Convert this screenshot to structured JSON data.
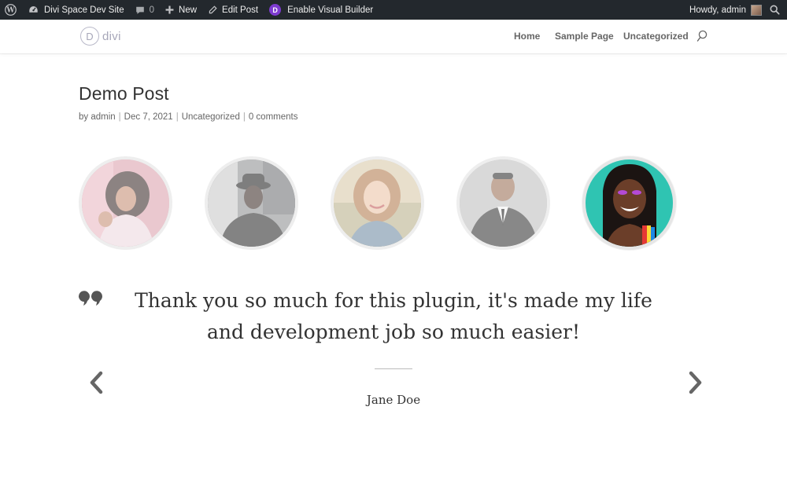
{
  "admin_bar": {
    "site_name": "Divi Space Dev Site",
    "comments_count": "0",
    "new_label": "New",
    "edit_label": "Edit Post",
    "divi_badge": "D",
    "visual_builder_label": "Enable Visual Builder",
    "howdy": "Howdy, admin"
  },
  "header": {
    "logo_letter": "D",
    "logo_text": "divi",
    "nav": [
      {
        "label": "Home"
      },
      {
        "label": "Sample Page"
      },
      {
        "label": "Uncategorized"
      }
    ]
  },
  "post": {
    "title": "Demo Post",
    "meta": {
      "by": "by admin",
      "date": "Dec 7, 2021",
      "category": "Uncategorized",
      "comments": "0 comments",
      "separator": "|"
    }
  },
  "testimonials": {
    "avatars": [
      {
        "name": "avatar-1",
        "active": false
      },
      {
        "name": "avatar-2",
        "active": false
      },
      {
        "name": "avatar-3",
        "active": false
      },
      {
        "name": "avatar-4",
        "active": false
      },
      {
        "name": "avatar-5",
        "active": true
      }
    ],
    "quote": "Thank you so much for this plugin, it's made my life and development job so much easier!",
    "author": "Jane Doe"
  },
  "icons": {
    "wordpress": "wordpress-icon",
    "dashboard": "dashboard-icon",
    "comment": "comment-icon",
    "plus": "plus-icon",
    "pencil": "pencil-icon",
    "search": "search-icon",
    "quote": "quote-icon",
    "prev": "chevron-left-icon",
    "next": "chevron-right-icon"
  },
  "colors": {
    "admin_bar_bg": "#23282d",
    "divi_purple": "#7e3bd0",
    "active_avatar_bg": "#2fc4b2",
    "text_dark": "#333333"
  }
}
